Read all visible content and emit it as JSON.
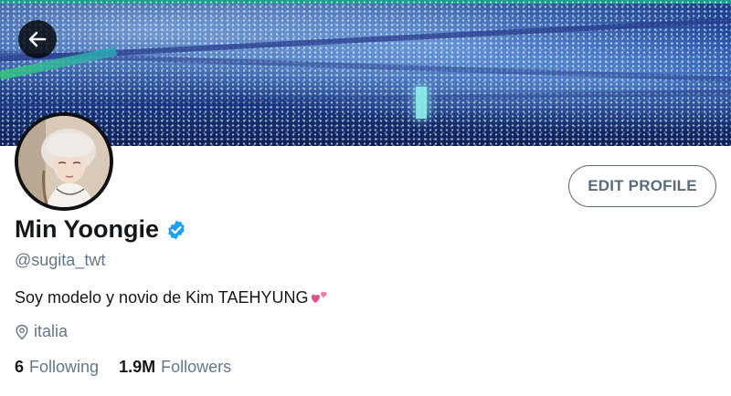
{
  "header": {
    "back_icon": "arrow-left-icon"
  },
  "profile": {
    "display_name": "Min Yoongie",
    "verified": true,
    "handle": "@sugita_twt",
    "bio": "Soy modelo y novio de Kim TAEHYUNG",
    "bio_emoji": "two-hearts-icon",
    "location": "italia",
    "edit_button_label": "EDIT PROFILE"
  },
  "stats": {
    "following_count": "6",
    "following_label": "Following",
    "followers_count": "1.9M",
    "followers_label": "Followers"
  },
  "colors": {
    "verified_blue": "#1da1f2",
    "secondary_text": "#657786",
    "primary_text": "#14171a",
    "edit_button_border": "#5d6c7a"
  }
}
